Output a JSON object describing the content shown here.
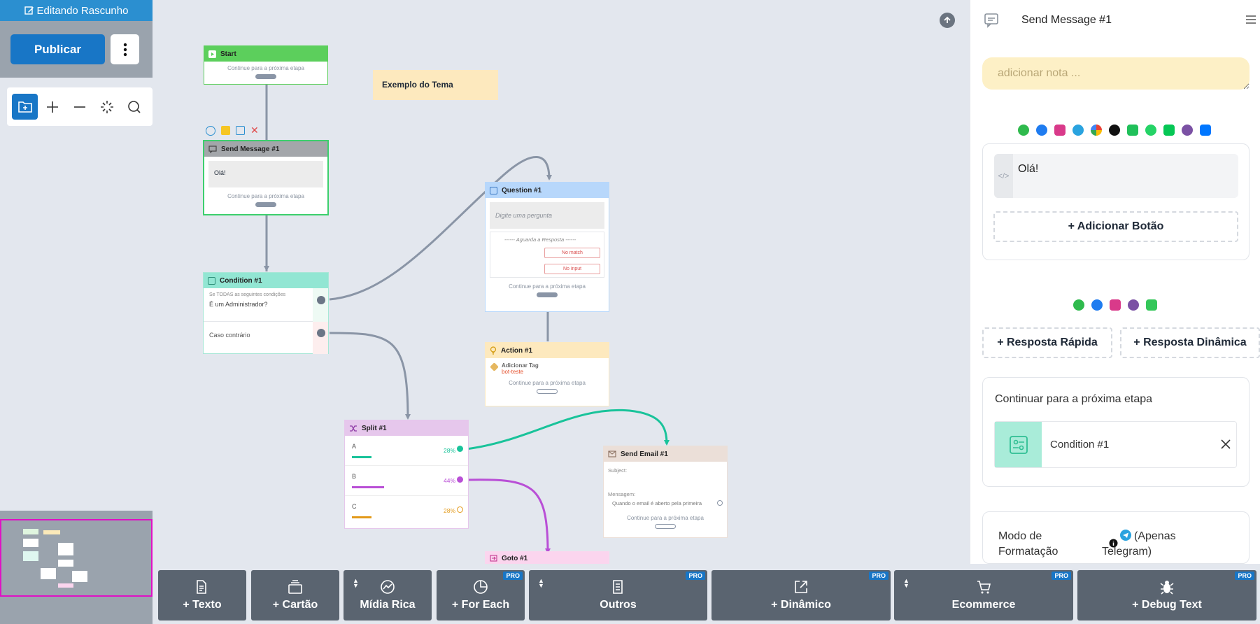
{
  "toolbar": {
    "draft_label": "Editando Rascunho",
    "publish_label": "Publicar"
  },
  "canvas": {
    "theme_note": "Exemplo do Tema",
    "nodes": {
      "start": {
        "title": "Start",
        "continue": "Continue para a próxima etapa"
      },
      "send_message": {
        "title": "Send Message #1",
        "text": "Olá!",
        "continue": "Continue para a próxima etapa"
      },
      "condition": {
        "title": "Condition #1",
        "rule_caption": "Se TODAS as seguintes condições",
        "rule": "É um Administrador?",
        "else": "Caso contrário"
      },
      "question": {
        "title": "Question #1",
        "placeholder": "Digite uma pergunta",
        "awaiting": "------ Aguarda a Resposta ------",
        "no_match": "No match",
        "no_input": "No input",
        "continue": "Continue para a próxima etapa"
      },
      "action": {
        "title": "Action #1",
        "action_label": "Adicionar Tag",
        "tag": "bot-teste",
        "continue": "Continue para a próxima etapa"
      },
      "split": {
        "title": "Split #1",
        "branches": [
          {
            "label": "A",
            "percent": "28%",
            "color": "#19c39a"
          },
          {
            "label": "B",
            "percent": "44%",
            "color": "#b94fd6"
          },
          {
            "label": "C",
            "percent": "28%",
            "color": "#e39a1a"
          }
        ]
      },
      "send_email": {
        "title": "Send Email #1",
        "subject": "Subject:",
        "message": "Mensagem:",
        "when_opened": "Quando o email é aberto pela primeira",
        "continue": "Continue para a próxima etapa"
      },
      "goto": {
        "title": "Goto #1"
      }
    }
  },
  "panel": {
    "title": "Send Message #1",
    "note_placeholder": "adicionar nota ...",
    "message_text": "Olá!",
    "add_button": "+ Adicionar Botão",
    "quick_reply": "+ Resposta Rápida",
    "dynamic_reply": "+ Resposta Dinâmica",
    "continue_title": "Continuar para a próxima etapa",
    "next_step": "Condition #1",
    "format_label": "Modo de Formatação",
    "format_note": "(Apenas Telegram)"
  },
  "bottom": {
    "buttons": [
      {
        "label": "+ Texto",
        "icon": "document-icon",
        "pro": ""
      },
      {
        "label": "+ Cartão",
        "icon": "card-icon",
        "pro": ""
      },
      {
        "label": "Mídia Rica",
        "icon": "media-icon",
        "pro": ""
      },
      {
        "label": "+ For Each",
        "icon": "pie-icon",
        "pro": "PRO"
      },
      {
        "label": "Outros",
        "icon": "list-icon",
        "pro": "PRO"
      },
      {
        "label": "+ Dinâmico",
        "icon": "external-link-icon",
        "pro": "PRO"
      },
      {
        "label": "Ecommerce",
        "icon": "cart-icon",
        "pro": "PRO"
      },
      {
        "label": "+ Debug Text",
        "icon": "bug-icon",
        "pro": "PRO"
      }
    ]
  },
  "colors": {
    "primary": "#1876c6",
    "start": "#5ccf5c",
    "message_header": "#a3a6aa",
    "condition_header": "#92e6d3",
    "question_header": "#b7d7fb",
    "action_header": "#fde9be",
    "split_header": "#e6c7ec",
    "email_header": "#ebdfd8",
    "goto_header": "#fbd5ee",
    "note_bg": "#fdf0c6"
  }
}
